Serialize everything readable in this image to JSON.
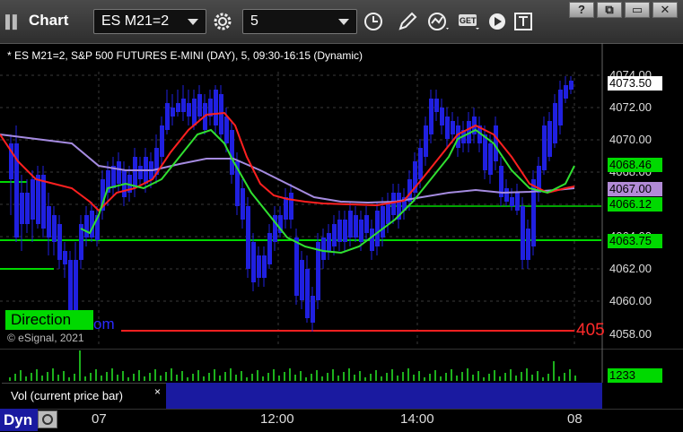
{
  "toolbar": {
    "app_title": "Chart",
    "symbol": "ES M21=2",
    "interval": "5",
    "get_label": "GET",
    "window_controls": [
      "?",
      "⧉",
      "▭",
      "✕"
    ]
  },
  "chart": {
    "info": "* ES M21=2, S&P 500 FUTURES E-MINI (DAY), 5, 09:30-16:15 (Dynamic)",
    "watermark": "© eSignal, 2021",
    "direction_label": "Direction",
    "direction_tail": "om",
    "red_tag": "405",
    "price_labels": [
      "4074.00",
      "4072.00",
      "4070.00",
      "4068.00",
      "4066.00",
      "4064.00",
      "4062.00",
      "4060.00",
      "4058.00"
    ],
    "tags": [
      {
        "text": "4073.50",
        "bg": "#ffffff"
      },
      {
        "text": "4068.46",
        "bg": "#00d900"
      },
      {
        "text": "4067.00",
        "bg": "#b28bd6"
      },
      {
        "text": "4066.12",
        "bg": "#00d900"
      },
      {
        "text": "4063.75",
        "bg": "#00d900"
      }
    ],
    "colors": {
      "bull": "#ffffff",
      "bear": "#2020e0",
      "ema_red": "#ff2020",
      "ema_green": "#30e030",
      "vwap_purple": "#a58be0",
      "level_green": "#00d900"
    }
  },
  "volume": {
    "legend": "Vol (current price bar)",
    "close_glyph": "×",
    "value": "1233"
  },
  "time_axis": {
    "dyn_label": "Dyn",
    "labels": [
      "07",
      "12:00",
      "14:00",
      "08"
    ]
  }
}
